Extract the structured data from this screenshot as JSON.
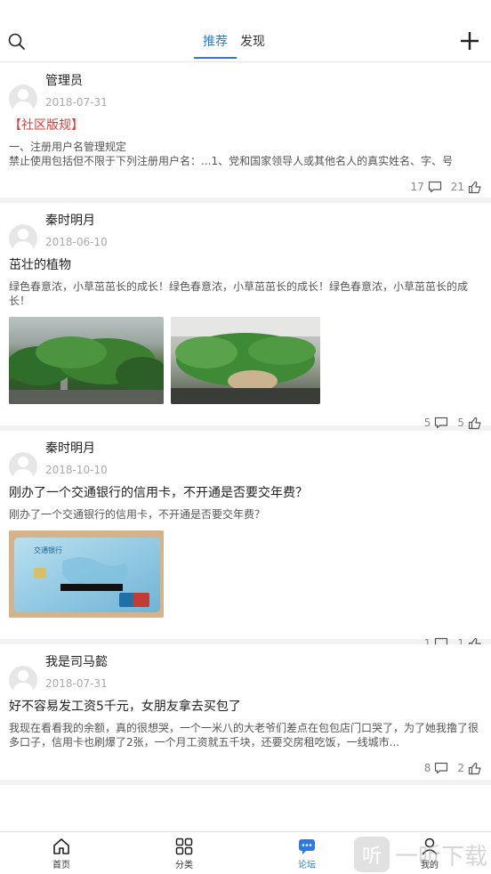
{
  "header": {
    "tabs": [
      {
        "label": "推荐",
        "active": true
      },
      {
        "label": "发现",
        "active": false
      }
    ]
  },
  "posts": [
    {
      "author": "管理员",
      "date": "2018-07-31",
      "title": "【社区版规】",
      "title_color": "#e53935",
      "body": "一、注册用户名管理规定\n禁止使用包括但不限于下列注册用户名：...1、党和国家领导人或其他名人的真实姓名、字、号",
      "images": [],
      "comments": "17",
      "likes": "21"
    },
    {
      "author": "秦时明月",
      "date": "2018-06-10",
      "title": "茁壮的植物",
      "body": "绿色春意浓，小草茁茁长的成长！绿色春意浓，小草茁茁长的成长！绿色春意浓，小草茁茁长的成长！",
      "images": [
        "plant-photo-1",
        "plant-photo-2"
      ],
      "comments": "5",
      "likes": "5"
    },
    {
      "author": "秦时明月",
      "date": "2018-10-10",
      "title": "刚办了一个交通银行的信用卡，不开通是否要交年费？",
      "body": "刚办了一个交通银行的信用卡，不开通是否要交年费？",
      "images": [
        "credit-card-photo"
      ],
      "comments": "1",
      "likes": "1"
    },
    {
      "author": "我是司马懿",
      "date": "2018-07-31",
      "title": "好不容易发工资5千元，女朋友拿去买包了",
      "body": "我现在看看我的余额，真的很想哭，一个一米八的大老爷们差点在包包店门口哭了，为了她我撸了很多口子，信用卡也刷爆了2张，一个月工资就五千块，还要交房租吃饭，一线城市...",
      "images": [],
      "comments": "8",
      "likes": "2"
    }
  ],
  "bottom_nav": [
    {
      "label": "首页",
      "icon": "home-icon",
      "active": false
    },
    {
      "label": "分类",
      "icon": "grid-icon",
      "active": false
    },
    {
      "label": "论坛",
      "icon": "forum-icon",
      "active": true
    },
    {
      "label": "我的",
      "icon": "user-icon",
      "active": false
    }
  ],
  "watermark": {
    "badge": "听",
    "text": "一听下载"
  },
  "colors": {
    "accent": "#2a7ae2",
    "notice_red": "#e53935"
  }
}
